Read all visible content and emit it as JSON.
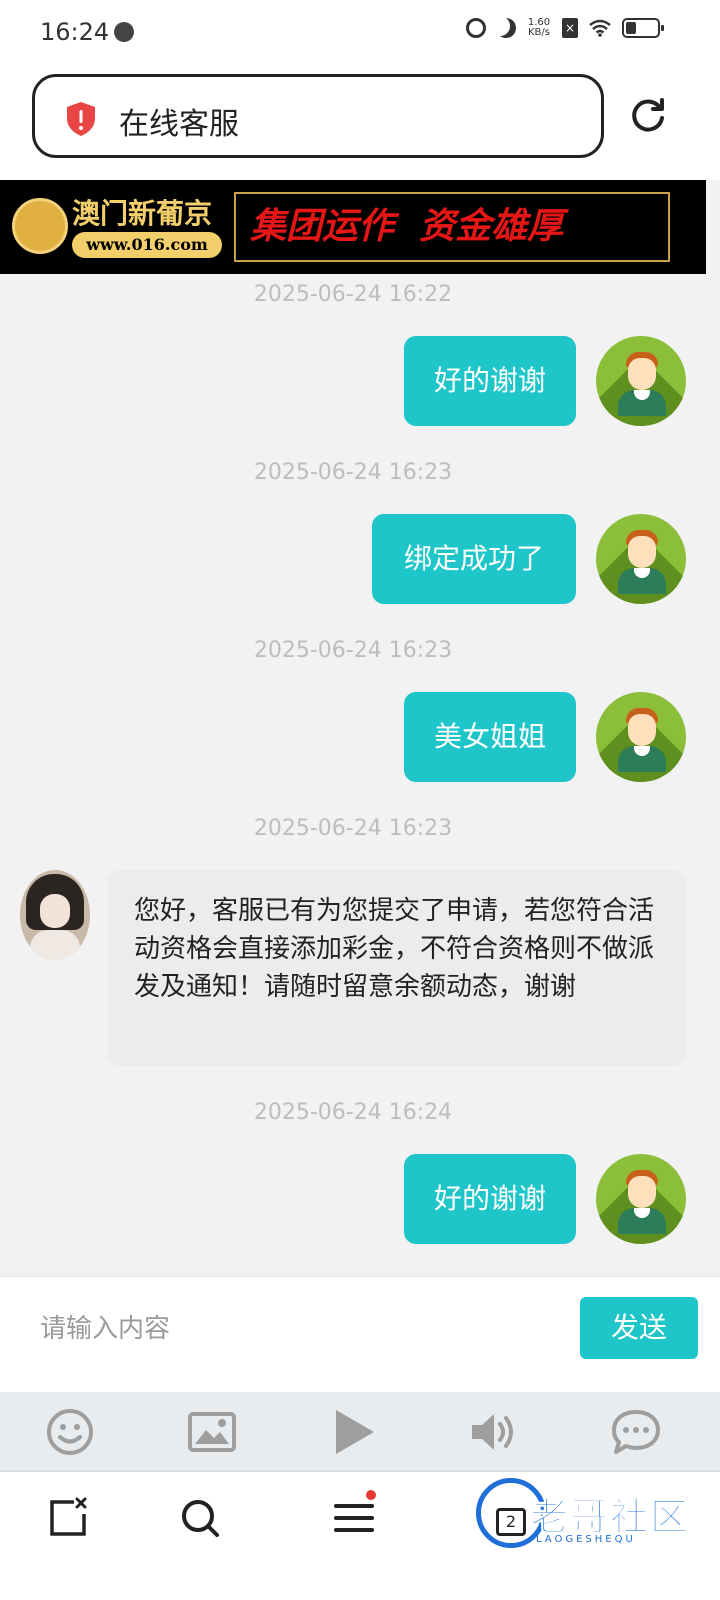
{
  "status_bar": {
    "time": "16:24",
    "net_speed_value": "1.60",
    "net_speed_unit": "KB/s",
    "battery_level": 0.25
  },
  "browser": {
    "url_title": "在线客服",
    "tabs_count": "2"
  },
  "banner": {
    "brand_name": "澳门新葡京",
    "brand_url": "www.016.com",
    "slogan": "集团运作  资金雄厚"
  },
  "messages": [
    {
      "time": "2025-06-24 16:22",
      "sender": "user",
      "text": "好的谢谢"
    },
    {
      "time": "2025-06-24 16:23",
      "sender": "user",
      "text": "绑定成功了"
    },
    {
      "time": "2025-06-24 16:23",
      "sender": "user",
      "text": "美女姐姐"
    },
    {
      "time": "2025-06-24 16:23",
      "sender": "agent",
      "text": "您好，客服已有为您提交了申请，若您符合活动资格会直接添加彩金，不符合资格则不做派发及通知！请随时留意余额动态，谢谢"
    },
    {
      "time": "2025-06-24 16:24",
      "sender": "user",
      "text": "好的谢谢"
    }
  ],
  "input": {
    "placeholder": "请输入内容",
    "send_label": "发送"
  },
  "toolbar": {
    "icons": [
      "emoji-icon",
      "image-icon",
      "play-icon",
      "speaker-icon",
      "chat-bubble-icon"
    ]
  },
  "watermark": {
    "text": "老哥社区",
    "sub": "LAOGESHEQU"
  },
  "colors": {
    "accent": "#1ec6c9",
    "user_avatar": "#8bbf3a",
    "agent_bubble": "#ebeced"
  }
}
